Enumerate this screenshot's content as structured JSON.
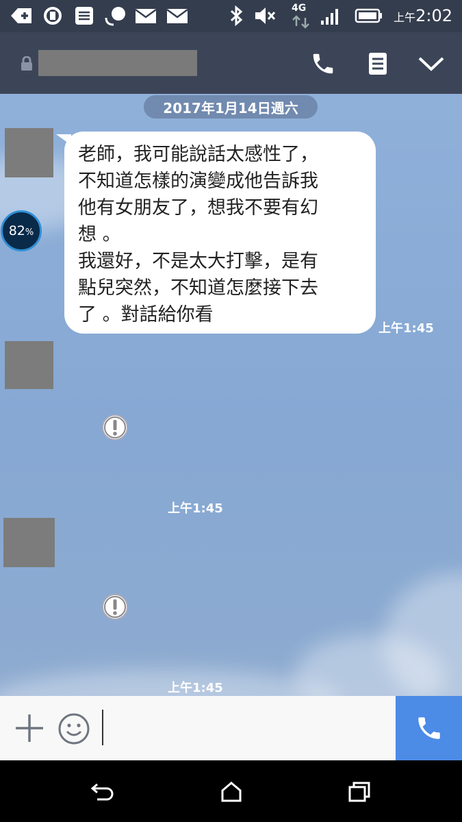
{
  "status_bar": {
    "time_prefix": "上午",
    "time": "2:02",
    "network": "4G",
    "icons": [
      "add-notification-icon",
      "sync-icon",
      "document-icon",
      "chat-icon",
      "mail-icon",
      "mail-icon",
      "bluetooth-icon",
      "mute-icon",
      "network-4g-icon",
      "signal-icon",
      "battery-icon"
    ]
  },
  "header": {
    "lock_icon": "lock-icon",
    "buttons": [
      "phone-icon",
      "note-icon",
      "chevron-down-icon"
    ]
  },
  "chat": {
    "date_label": "2017年1月14日週六",
    "battery_badge": "82",
    "battery_badge_unit": "%",
    "messages": [
      {
        "text": "老師，我可能說話太感性了，\n不知道怎樣的演變成他告訴我\n他有女朋友了，想我不要有幻\n想 。\n我還好，不是太大打擊，是有\n點兒突然，不知道怎麼接下去\n了 。對話給你看",
        "time": "上午1:45"
      },
      {
        "time": "上午1:45",
        "status_icon": "error-icon"
      },
      {
        "time": "上午1:45",
        "status_icon": "error-icon"
      }
    ]
  },
  "input_bar": {
    "value": "",
    "icons": [
      "plus-icon",
      "emoji-icon",
      "call-icon"
    ]
  },
  "nav_bar": {
    "icons": [
      "back-icon",
      "home-icon",
      "recents-icon"
    ]
  }
}
